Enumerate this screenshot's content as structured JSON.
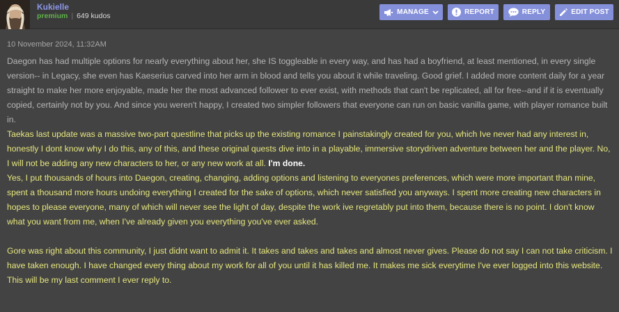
{
  "post": {
    "author": "Kukielle",
    "membership": "premium",
    "kudos": "649 kudos",
    "timestamp": "10 November 2024, 11:32AM"
  },
  "actions": {
    "manage": "MANAGE",
    "report": "REPORT",
    "reply": "REPLY",
    "edit": "EDIT POST"
  },
  "icons": {
    "manage": "megaphone-icon",
    "manage_caret": "chevron-down-icon",
    "report": "exclamation-circle-icon",
    "reply": "speech-bubble-icon",
    "edit": "pencil-icon"
  },
  "colors": {
    "background": "#434343",
    "header": "#3a3a3a",
    "accent": "#8590da",
    "username": "#8d97e8",
    "premium": "#5fb24a",
    "quote_text": "#b7b7b7",
    "reply_text": "#e7e77f"
  },
  "content": {
    "quoted_paragraph": "Daegon has had multiple options for nearly everything about her, she IS toggleable in every way, and has had a boyfriend, at least mentioned, in every single version-- in Legacy, she even has Kaeserius carved into her arm in blood and tells you about it while traveling. Good grief. I added more content daily for a year straight to make her more enjoyable, made her the most advanced follower to ever exist, with methods that can't be replicated, all for free--and if it is eventually copied, certainly not by you. And since you weren't happy, I created two simpler followers that everyone can run on basic vanilla game, with player romance built in.",
    "reply_paragraph_1": "Taekas last update was a massive two-part questline that picks up the existing romance I painstakingly created for you, which Ive never had any interest in, honestly I dont know why I do this, any of this, and these original quests dive into in a playable, immersive storydriven adventure between her and the player. No, I will not be adding any new characters to her, or any new work at all.",
    "reply_emphasis": "I'm done.",
    "reply_paragraph_2": "Yes, I put thousands of hours into Daegon, creating, changing, adding options and listening to everyones preferences, which were more important than mine, spent a thousand more hours undoing everything I created for the sake of options, which never satisfied you anyways. I spent more creating new characters in hopes to please everyone, many of which will never see the light of day, despite the work ive regretably put into them, because there is no point. I don't know what you want from me, when I've already given you everything you've ever asked.",
    "reply_paragraph_3": "Gore was right about this community, I just didnt want to admit it. It takes and takes and takes and almost never gives. Please do not say I can not take criticism. I have taken enough. I have changed every thing about my work for all of you until it has killed me. It makes me sick everytime I've ever logged into this website.",
    "reply_paragraph_4": "This will be my last comment I ever reply to."
  }
}
